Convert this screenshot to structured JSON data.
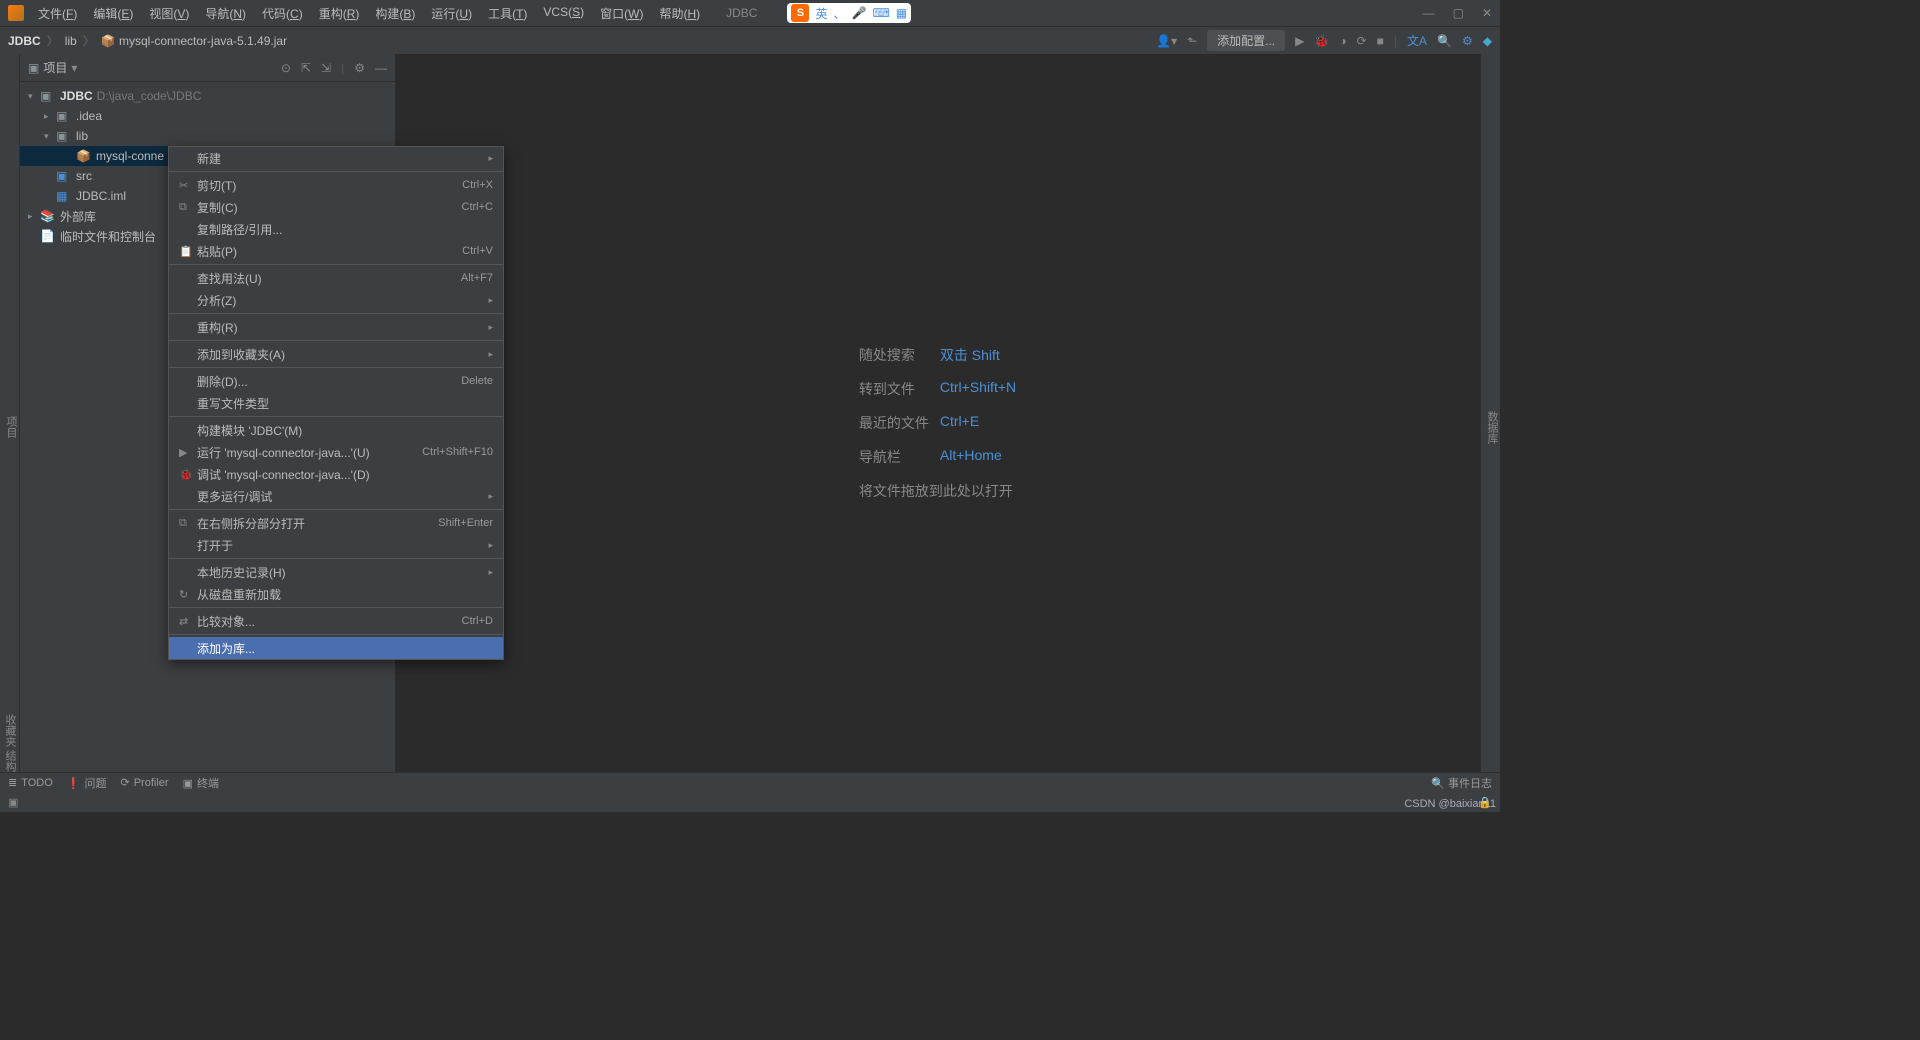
{
  "menubar": [
    "文件(F)",
    "编辑(E)",
    "视图(V)",
    "导航(N)",
    "代码(C)",
    "重构(R)",
    "构建(B)",
    "运行(U)",
    "工具(T)",
    "VCS(S)",
    "窗口(W)",
    "帮助(H)"
  ],
  "title_center": "JDBC",
  "ime": {
    "lang": "英",
    "icon": "S"
  },
  "breadcrumb": [
    "JDBC",
    "lib",
    "mysql-connector-java-5.1.49.jar"
  ],
  "nav_add": "添加配置...",
  "sidebar_title": "项目",
  "tree": {
    "root": {
      "name": "JDBC",
      "path": "D:\\java_code\\JDBC"
    },
    "idea": ".idea",
    "lib": "lib",
    "jar": "mysql-conne",
    "src": "src",
    "iml": "JDBC.iml",
    "ext": "外部库",
    "scratch": "临时文件和控制台"
  },
  "context_menu": [
    {
      "type": "item",
      "label": "新建",
      "submenu": true
    },
    {
      "type": "sep"
    },
    {
      "type": "item",
      "icon": "✂",
      "label": "剪切(T)",
      "shortcut": "Ctrl+X"
    },
    {
      "type": "item",
      "icon": "⧉",
      "label": "复制(C)",
      "shortcut": "Ctrl+C"
    },
    {
      "type": "item",
      "label": "复制路径/引用..."
    },
    {
      "type": "item",
      "icon": "📋",
      "label": "粘贴(P)",
      "shortcut": "Ctrl+V"
    },
    {
      "type": "sep"
    },
    {
      "type": "item",
      "label": "查找用法(U)",
      "shortcut": "Alt+F7"
    },
    {
      "type": "item",
      "label": "分析(Z)",
      "submenu": true
    },
    {
      "type": "sep"
    },
    {
      "type": "item",
      "label": "重构(R)",
      "submenu": true
    },
    {
      "type": "sep"
    },
    {
      "type": "item",
      "label": "添加到收藏夹(A)",
      "submenu": true
    },
    {
      "type": "sep"
    },
    {
      "type": "item",
      "label": "删除(D)...",
      "shortcut": "Delete"
    },
    {
      "type": "item",
      "label": "重写文件类型"
    },
    {
      "type": "sep"
    },
    {
      "type": "item",
      "label": "构建模块 'JDBC'(M)"
    },
    {
      "type": "item",
      "icon": "▶",
      "iconClass": "green",
      "label": "运行 'mysql-connector-java...'(U)",
      "shortcut": "Ctrl+Shift+F10"
    },
    {
      "type": "item",
      "icon": "🐞",
      "iconClass": "orange",
      "label": "调试 'mysql-connector-java...'(D)"
    },
    {
      "type": "item",
      "label": "更多运行/调试",
      "submenu": true
    },
    {
      "type": "sep"
    },
    {
      "type": "item",
      "icon": "⧉",
      "label": "在右侧拆分部分打开",
      "shortcut": "Shift+Enter"
    },
    {
      "type": "item",
      "label": "打开于",
      "submenu": true
    },
    {
      "type": "sep"
    },
    {
      "type": "item",
      "label": "本地历史记录(H)",
      "submenu": true
    },
    {
      "type": "item",
      "icon": "↻",
      "label": "从磁盘重新加载"
    },
    {
      "type": "sep"
    },
    {
      "type": "item",
      "icon": "⇄",
      "label": "比较对象...",
      "shortcut": "Ctrl+D"
    },
    {
      "type": "sep"
    },
    {
      "type": "item",
      "label": "添加为库...",
      "highlighted": true
    }
  ],
  "hints": [
    {
      "label": "随处搜索",
      "key": "双击 Shift"
    },
    {
      "label": "转到文件",
      "key": "Ctrl+Shift+N"
    },
    {
      "label": "最近的文件",
      "key": "Ctrl+E"
    },
    {
      "label": "导航栏",
      "key": "Alt+Home"
    }
  ],
  "hints_drag": "将文件拖放到此处以打开",
  "bottom_bar": [
    {
      "icon": "≣",
      "label": "TODO"
    },
    {
      "icon": "❗",
      "label": "问题"
    },
    {
      "icon": "⟳",
      "label": "Profiler"
    },
    {
      "icon": "▣",
      "label": "终端"
    }
  ],
  "bottom_right": "事件日志",
  "left_gutter_top": "项目",
  "left_gutter_bottom": "收藏夹   结构",
  "right_gutter": "数据库",
  "watermark": "CSDN @baixian11"
}
